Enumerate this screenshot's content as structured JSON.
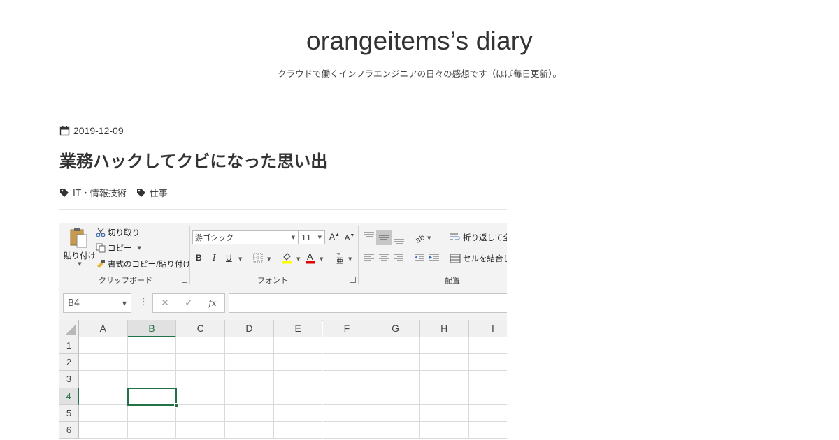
{
  "blog": {
    "title": "orangeitems’s diary",
    "description": "クラウドで働くインフラエンジニアの日々の感想です（ほぼ毎日更新）。"
  },
  "entry": {
    "date": "2019-12-09",
    "title": "業務ハックしてクビになった思い出",
    "tags": [
      "IT・情報技術",
      "仕事"
    ]
  },
  "excel": {
    "clipboard": {
      "paste_label": "貼り付け",
      "cut_label": "切り取り",
      "copy_label": "コピー",
      "format_painter_label": "書式のコピー/貼り付け",
      "group_label": "クリップボード"
    },
    "font": {
      "font_name": "游ゴシック",
      "font_size": "11",
      "bold": "B",
      "italic": "I",
      "underline": "U",
      "group_label": "フォント"
    },
    "alignment": {
      "wrap_text_label": "折り返して全体",
      "merge_label": "セルを結合し",
      "group_label": "配置"
    },
    "name_box": "B4",
    "fx_label": "fx",
    "columns": [
      "A",
      "B",
      "C",
      "D",
      "E",
      "F",
      "G",
      "H",
      "I"
    ],
    "rows": [
      "1",
      "2",
      "3",
      "4",
      "5",
      "6"
    ],
    "selected_column": "B",
    "selected_row": "4",
    "colors": {
      "accent": "#217346"
    }
  }
}
